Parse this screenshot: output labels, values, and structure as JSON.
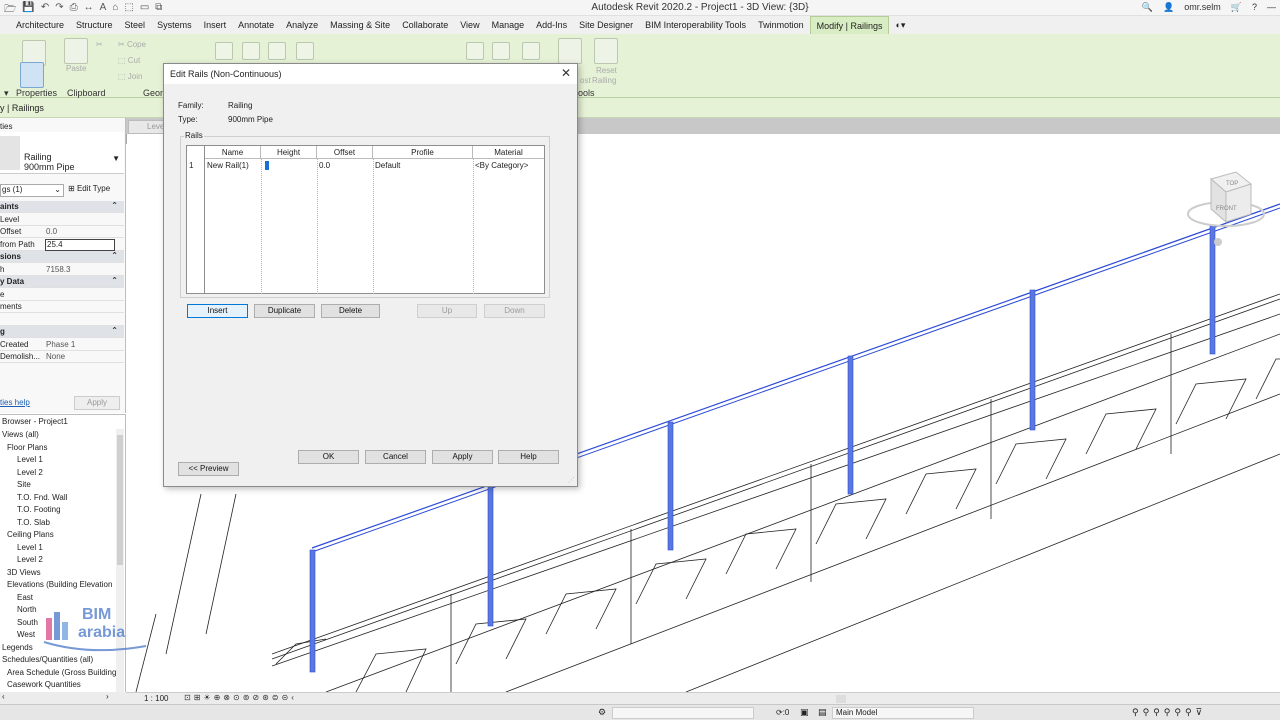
{
  "app": {
    "title": "Autodesk Revit 2020.2 - Project1 - 3D View: {3D}",
    "user": "omr.selm"
  },
  "ribbon": {
    "tabs": [
      "Architecture",
      "Structure",
      "Steel",
      "Systems",
      "Insert",
      "Annotate",
      "Analyze",
      "Massing & Site",
      "Collaborate",
      "View",
      "Manage",
      "Add-Ins",
      "Site Designer",
      "BIM Interoperability Tools",
      "Twinmotion",
      "Modify | Railings"
    ],
    "active_tab": "Modify | Railings",
    "groups": {
      "properties": "Properties",
      "clipboard": "Clipboard",
      "geometry": "Geom",
      "tools": "ools"
    },
    "tools": {
      "paste": "Paste",
      "cope": "Cope",
      "cut": "Cut",
      "join": "Join",
      "reset_railing_line1": "Reset",
      "reset_railing_line2": "Railing",
      "ost": "ost"
    }
  },
  "context": {
    "label": "y | Railings"
  },
  "view_tab": "Leve",
  "properties_panel": {
    "header": "ties",
    "family": "Railing",
    "type": "900mm Pipe",
    "filter": "gs (1)",
    "edit_type": "Edit Type",
    "rows": [
      {
        "k": "aints",
        "v": "",
        "cat": true
      },
      {
        "k": "Level",
        "v": ""
      },
      {
        "k": "Offset",
        "v": "0.0"
      },
      {
        "k": "from Path",
        "v": "25.4",
        "edit": true
      },
      {
        "k": "sions",
        "v": "",
        "cat": true
      },
      {
        "k": "h",
        "v": "7158.3"
      },
      {
        "k": "y Data",
        "v": "",
        "cat": true
      },
      {
        "k": "e",
        "v": ""
      },
      {
        "k": "ments",
        "v": ""
      },
      {
        "k": "",
        "v": ""
      },
      {
        "k": "g",
        "v": "",
        "cat": true
      },
      {
        "k": "Created",
        "v": "Phase 1"
      },
      {
        "k": "Demolish...",
        "v": "None"
      }
    ],
    "help": "ties help",
    "apply": "Apply"
  },
  "project_browser": {
    "header": "Browser - Project1",
    "items": [
      {
        "label": "Views (all)",
        "indent": 0
      },
      {
        "label": "Floor Plans",
        "indent": 1
      },
      {
        "label": "Level 1",
        "indent": 3
      },
      {
        "label": "Level 2",
        "indent": 3
      },
      {
        "label": "Site",
        "indent": 3
      },
      {
        "label": "T.O. Fnd. Wall",
        "indent": 3
      },
      {
        "label": "T.O. Footing",
        "indent": 3
      },
      {
        "label": "T.O. Slab",
        "indent": 3
      },
      {
        "label": "Ceiling Plans",
        "indent": 1
      },
      {
        "label": "Level 1",
        "indent": 3
      },
      {
        "label": "Level 2",
        "indent": 3
      },
      {
        "label": "3D Views",
        "indent": 1
      },
      {
        "label": "Elevations (Building Elevation",
        "indent": 1
      },
      {
        "label": "East",
        "indent": 3
      },
      {
        "label": "North",
        "indent": 3
      },
      {
        "label": "South",
        "indent": 3
      },
      {
        "label": "West",
        "indent": 3
      },
      {
        "label": "Legends",
        "indent": 0
      },
      {
        "label": "Schedules/Quantities (all)",
        "indent": 0
      },
      {
        "label": "Area Schedule (Gross Building",
        "indent": 1
      },
      {
        "label": "Casework Quantities",
        "indent": 1
      }
    ]
  },
  "watermark": {
    "line1": "BIM",
    "line2": "arabia"
  },
  "viewcube": {
    "top": "TOP",
    "front": "FRONT"
  },
  "view_bar": {
    "scale": "1 : 100"
  },
  "status_bar": {
    "counter": ":0",
    "model": "Main Model"
  },
  "dialog": {
    "title": "Edit Rails (Non-Continuous)",
    "family_label": "Family:",
    "family_value": "Railing",
    "type_label": "Type:",
    "type_value": "900mm Pipe",
    "group_label": "Rails",
    "columns": [
      "Name",
      "Height",
      "Offset",
      "Profile",
      "Material"
    ],
    "rows": [
      {
        "num": "1",
        "name": "New Rail(1)",
        "height": "",
        "offset": "0.0",
        "profile": "Default",
        "material": "<By Category>"
      }
    ],
    "buttons": {
      "insert": "Insert",
      "duplicate": "Duplicate",
      "delete": "Delete",
      "up": "Up",
      "down": "Down",
      "ok": "OK",
      "cancel": "Cancel",
      "apply": "Apply",
      "help": "Help",
      "preview": "<< Preview"
    }
  },
  "colors": {
    "ribbon_bg": "#e6f2d6",
    "selected_blue": "#2d4bd6",
    "accent": "#0078d7"
  }
}
